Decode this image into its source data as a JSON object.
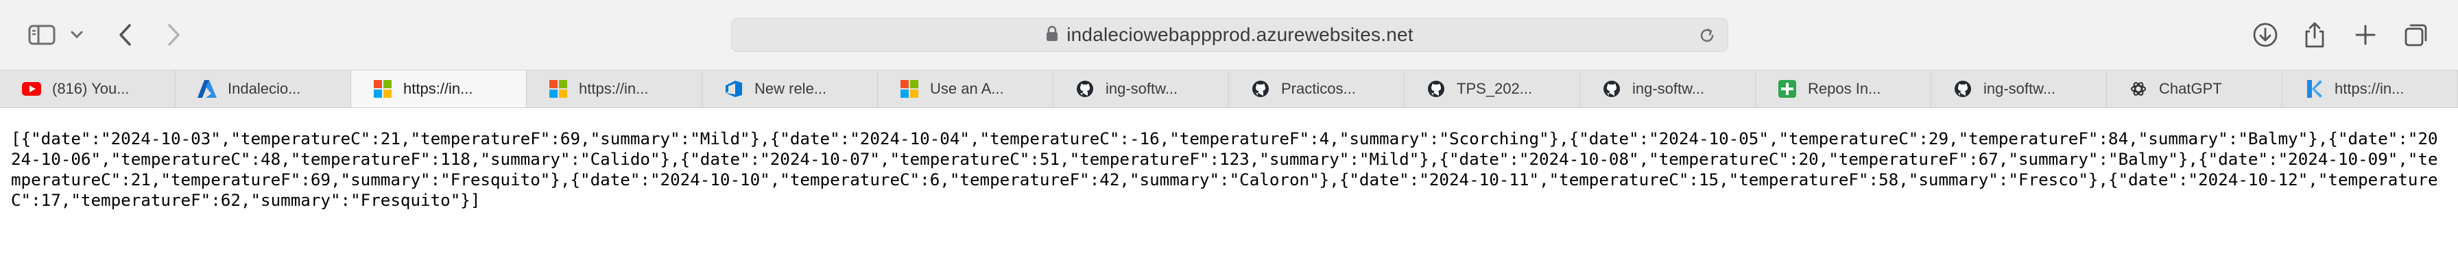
{
  "browser": {
    "url": "indaleciowebappprod.azurewebsites.net",
    "icons": [
      "sidebar-icon",
      "chevron-down-icon",
      "back-icon",
      "forward-icon",
      "lock-icon",
      "reload-icon",
      "download-icon",
      "share-icon",
      "new-tab-icon",
      "tab-overview-icon"
    ]
  },
  "tabs": [
    {
      "label": "(816) You...",
      "icon": "youtube-icon",
      "active": false
    },
    {
      "label": "Indalecio...",
      "icon": "azure-icon",
      "active": false
    },
    {
      "label": "https://in...",
      "icon": "microsoft-icon",
      "active": true
    },
    {
      "label": "https://in...",
      "icon": "microsoft-icon",
      "active": false
    },
    {
      "label": "New rele...",
      "icon": "azure-devops-icon",
      "active": false
    },
    {
      "label": "Use an A...",
      "icon": "microsoft-icon",
      "active": false
    },
    {
      "label": "ing-softw...",
      "icon": "github-icon",
      "active": false
    },
    {
      "label": "Practicos...",
      "icon": "github-icon",
      "active": false
    },
    {
      "label": "TPS_202...",
      "icon": "github-icon",
      "active": false
    },
    {
      "label": "ing-softw...",
      "icon": "github-icon",
      "active": false
    },
    {
      "label": "Repos In...",
      "icon": "green-plus-icon",
      "active": false
    },
    {
      "label": "ing-softw...",
      "icon": "github-icon",
      "active": false
    },
    {
      "label": "ChatGPT",
      "icon": "chatgpt-icon",
      "active": false
    },
    {
      "label": "https://in...",
      "icon": "k-icon",
      "active": false
    }
  ],
  "content": {
    "json_text": "[{\"date\":\"2024-10-03\",\"temperatureC\":21,\"temperatureF\":69,\"summary\":\"Mild\"},{\"date\":\"2024-10-04\",\"temperatureC\":-16,\"temperatureF\":4,\"summary\":\"Scorching\"},{\"date\":\"2024-10-05\",\"temperatureC\":29,\"temperatureF\":84,\"summary\":\"Balmy\"},{\"date\":\"2024-10-06\",\"temperatureC\":48,\"temperatureF\":118,\"summary\":\"Calido\"},{\"date\":\"2024-10-07\",\"temperatureC\":51,\"temperatureF\":123,\"summary\":\"Mild\"},{\"date\":\"2024-10-08\",\"temperatureC\":20,\"temperatureF\":67,\"summary\":\"Balmy\"},{\"date\":\"2024-10-09\",\"temperatureC\":21,\"temperatureF\":69,\"summary\":\"Fresquito\"},{\"date\":\"2024-10-10\",\"temperatureC\":6,\"temperatureF\":42,\"summary\":\"Caloron\"},{\"date\":\"2024-10-11\",\"temperatureC\":15,\"temperatureF\":58,\"summary\":\"Fresco\"},{\"date\":\"2024-10-12\",\"temperatureC\":17,\"temperatureF\":62,\"summary\":\"Fresquito\"}]"
  }
}
